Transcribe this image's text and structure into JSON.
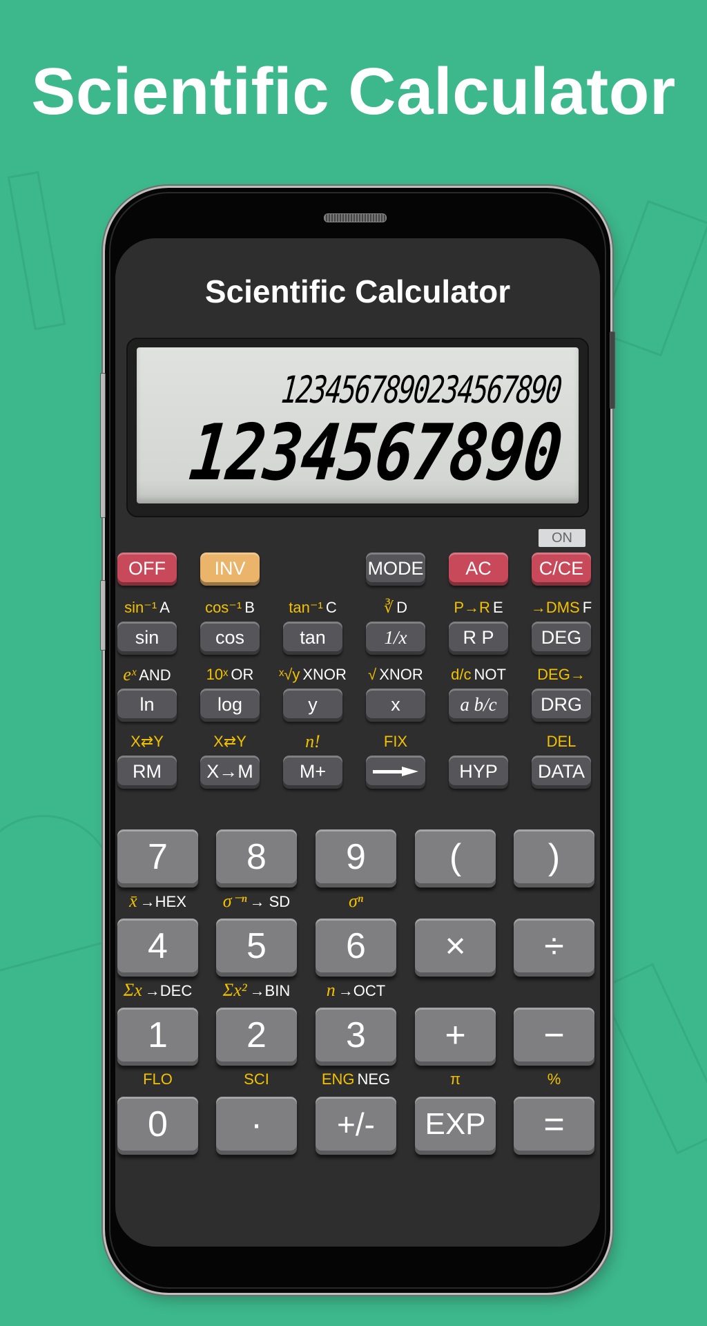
{
  "headline": "Scientific Calculator",
  "app": {
    "title": "Scientific Calculator",
    "display": {
      "secondary_line": "1234567890234567890",
      "primary_line": "1234567890"
    },
    "on_indicator": "ON"
  },
  "colors": {
    "background": "#3db78c",
    "screen": "#2e2e2e",
    "lcd": "#d9dcd8",
    "key_gray": "#56565a",
    "key_number": "#7f7f81",
    "key_red": "#c84a5a",
    "key_orange": "#eab46a",
    "label_yellow": "#f2c200"
  },
  "function_rows": [
    {
      "keys": [
        {
          "label": "OFF",
          "style": "red",
          "col": 0
        },
        {
          "label": "INV",
          "style": "orange",
          "col": 1
        },
        {
          "label": "MODE",
          "style": "gray",
          "col": 3
        },
        {
          "label": "AC",
          "style": "red",
          "col": 4
        },
        {
          "label": "C/CE",
          "style": "red",
          "col": 5
        }
      ],
      "labels": []
    },
    {
      "keys": [
        {
          "label": "sin",
          "style": "gray",
          "col": 0
        },
        {
          "label": "cos",
          "style": "gray",
          "col": 1
        },
        {
          "label": "tan",
          "style": "gray",
          "col": 2
        },
        {
          "label": "1/x",
          "style": "gray italic",
          "col": 3
        },
        {
          "label": "R   P",
          "style": "gray",
          "col": 4
        },
        {
          "label": "DEG",
          "style": "gray",
          "col": 5
        }
      ],
      "labels": [
        {
          "yellow": "sin⁻¹",
          "white": "A"
        },
        {
          "yellow": "cos⁻¹",
          "white": "B"
        },
        {
          "yellow": "tan⁻¹",
          "white": "C"
        },
        {
          "yellow": "∛",
          "white": "D"
        },
        {
          "yellow": "P→R",
          "white": "E"
        },
        {
          "yellow": "→DMS",
          "white": "F"
        }
      ]
    },
    {
      "keys": [
        {
          "label": "ln",
          "style": "gray",
          "col": 0
        },
        {
          "label": "log",
          "style": "gray",
          "col": 1
        },
        {
          "label": "y",
          "style": "gray",
          "col": 2
        },
        {
          "label": "x",
          "style": "gray",
          "col": 3
        },
        {
          "label": "a b/c",
          "style": "gray italic",
          "col": 4
        },
        {
          "label": "DRG",
          "style": "gray",
          "col": 5
        }
      ],
      "labels": [
        {
          "yellow": "eˣ",
          "white": "AND"
        },
        {
          "yellow": "10ˣ",
          "white": "OR"
        },
        {
          "yellow": "ˣ√y",
          "white": "XNOR"
        },
        {
          "yellow": "√",
          "white": "XNOR"
        },
        {
          "yellow": "d/c",
          "white": "NOT"
        },
        {
          "yellow": "DEG→",
          "white": ""
        }
      ]
    },
    {
      "keys": [
        {
          "label": "RM",
          "style": "gray",
          "col": 0
        },
        {
          "label": "X→M",
          "style": "gray",
          "col": 1
        },
        {
          "label": "M+",
          "style": "gray",
          "col": 2
        },
        {
          "label": "→",
          "style": "gray",
          "col": 3
        },
        {
          "label": "HYP",
          "style": "gray",
          "col": 4
        },
        {
          "label": "DATA",
          "style": "gray",
          "col": 5
        }
      ],
      "labels": [
        {
          "yellow": "X⇄Y",
          "white": ""
        },
        {
          "yellow": "X⇄Y",
          "white": ""
        },
        {
          "yellow": "n!",
          "white": ""
        },
        {
          "yellow": "FIX",
          "white": ""
        },
        {
          "yellow": "",
          "white": ""
        },
        {
          "yellow": "DEL",
          "white": ""
        }
      ]
    }
  ],
  "number_rows": [
    {
      "keys": [
        "7",
        "8",
        "9",
        "(",
        ")"
      ],
      "labels": [
        {
          "yellow": "x̄",
          "white": "→HEX"
        },
        {
          "yellow": "σ⁻ⁿ",
          "white": "→ SD"
        },
        {
          "yellow": "σⁿ",
          "white": ""
        },
        {
          "yellow": "",
          "white": ""
        },
        {
          "yellow": "",
          "white": ""
        }
      ]
    },
    {
      "keys": [
        "4",
        "5",
        "6",
        "×",
        "÷"
      ],
      "labels": [
        {
          "yellow": "Σx",
          "white": "→DEC"
        },
        {
          "yellow": "Σx²",
          "white": "→BIN"
        },
        {
          "yellow": "n",
          "white": "→OCT"
        },
        {
          "yellow": "",
          "white": ""
        },
        {
          "yellow": "",
          "white": ""
        }
      ]
    },
    {
      "keys": [
        "1",
        "2",
        "3",
        "+",
        "−"
      ],
      "labels": [
        {
          "yellow": "FLO",
          "white": ""
        },
        {
          "yellow": "SCI",
          "white": ""
        },
        {
          "yellow": "ENG",
          "white": "NEG"
        },
        {
          "yellow": "π",
          "white": ""
        },
        {
          "yellow": "%",
          "white": ""
        }
      ]
    },
    {
      "keys": [
        "0",
        "·",
        "+/-",
        "EXP",
        "="
      ],
      "labels": []
    }
  ]
}
